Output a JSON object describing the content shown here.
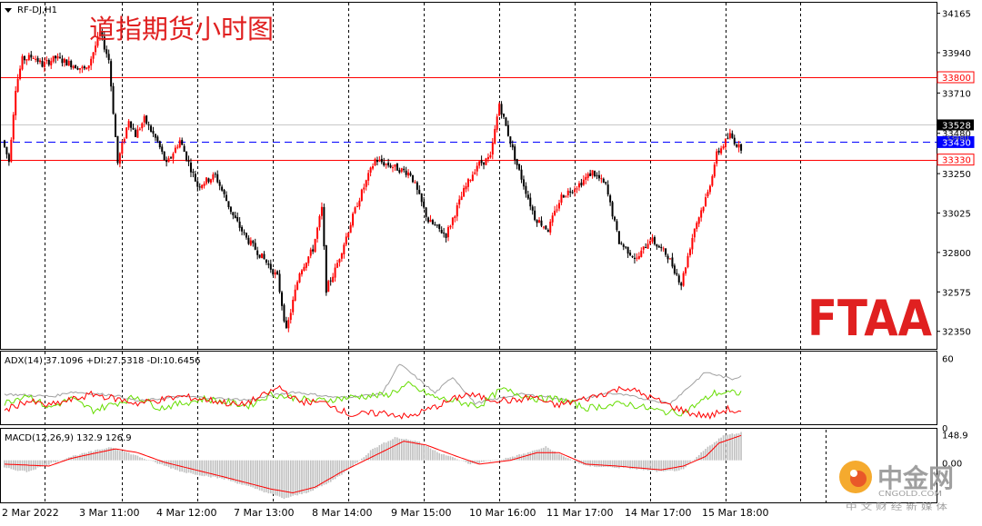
{
  "window": {
    "symbol_label": "RF-DJ,H1",
    "title": "道指期货小时图",
    "watermark_brand": "FTAA",
    "watermark_cn": "中金网",
    "watermark_site": "CNGOLD.COM",
    "watermark_sub": "中 文 财 经 新 媒 体"
  },
  "colors": {
    "bull": "#ff0000",
    "bear": "#000000",
    "level_red": "#ff0000",
    "level_blue": "#0000ff",
    "adx_line": "#a0a0a0",
    "di_plus": "#66dd00",
    "di_minus": "#ff0000",
    "macd_hist": "#c0c0c0",
    "macd_signal": "#ff0000",
    "brand_red": "#e02020"
  },
  "chart_data": [
    {
      "type": "candlestick",
      "title": "道指期货小时图",
      "symbol": "RF-DJ,H1",
      "ylim": [
        32250,
        34220
      ],
      "y_ticks": [
        34165,
        33940,
        33710,
        33480,
        33250,
        33025,
        32800,
        32575,
        32350
      ],
      "x_tick_labels": [
        "2 Mar 2022",
        "3 Mar 11:00",
        "4 Mar 12:00",
        "7 Mar 13:00",
        "8 Mar 14:00",
        "9 Mar 15:00",
        "10 Mar 16:00",
        "11 Mar 17:00",
        "14 Mar 17:00",
        "15 Mar 18:00"
      ],
      "levels": [
        {
          "value": 33800,
          "label": "33800",
          "color": "red"
        },
        {
          "value": 33430,
          "label": "33430",
          "color": "blue",
          "style": "dashed"
        },
        {
          "value": 33330,
          "label": "33330",
          "color": "red"
        }
      ],
      "last_price": {
        "value": 33528,
        "label": "33528"
      },
      "hidden_label": "33480",
      "path": [
        [
          0,
          33440
        ],
        [
          3,
          33320
        ],
        [
          6,
          33740
        ],
        [
          9,
          33900
        ],
        [
          14,
          33920
        ],
        [
          18,
          33870
        ],
        [
          24,
          33910
        ],
        [
          30,
          33880
        ],
        [
          38,
          33840
        ],
        [
          44,
          34050
        ],
        [
          48,
          33900
        ],
        [
          52,
          33310
        ],
        [
          57,
          33560
        ],
        [
          60,
          33470
        ],
        [
          64,
          33560
        ],
        [
          70,
          33430
        ],
        [
          74,
          33300
        ],
        [
          80,
          33440
        ],
        [
          88,
          33180
        ],
        [
          96,
          33240
        ],
        [
          104,
          33010
        ],
        [
          110,
          32880
        ],
        [
          118,
          32760
        ],
        [
          124,
          32660
        ],
        [
          128,
          32350
        ],
        [
          134,
          32690
        ],
        [
          140,
          32820
        ],
        [
          144,
          33050
        ],
        [
          146,
          32590
        ],
        [
          150,
          32700
        ],
        [
          160,
          33080
        ],
        [
          168,
          33330
        ],
        [
          174,
          33300
        ],
        [
          184,
          33250
        ],
        [
          192,
          32980
        ],
        [
          200,
          32900
        ],
        [
          208,
          33150
        ],
        [
          214,
          33300
        ],
        [
          220,
          33340
        ],
        [
          224,
          33650
        ],
        [
          232,
          33300
        ],
        [
          240,
          33000
        ],
        [
          246,
          32930
        ],
        [
          252,
          33120
        ],
        [
          260,
          33190
        ],
        [
          266,
          33260
        ],
        [
          272,
          33180
        ],
        [
          278,
          32860
        ],
        [
          286,
          32760
        ],
        [
          292,
          32880
        ],
        [
          300,
          32780
        ],
        [
          306,
          32620
        ],
        [
          312,
          32940
        ],
        [
          318,
          33140
        ],
        [
          322,
          33360
        ],
        [
          328,
          33470
        ],
        [
          332,
          33400
        ]
      ]
    },
    {
      "type": "line",
      "title": "ADX(14) 37.1096 +DI:27.5318 -DI:10.6456",
      "adx": 37.1096,
      "plus_di": 27.5318,
      "minus_di": 10.6456,
      "ylim": [
        0,
        62
      ],
      "y_ticks": [
        60,
        0
      ],
      "series": [
        {
          "name": "ADX",
          "key": "adx",
          "path": [
            [
              0,
              26
            ],
            [
              22,
              24
            ],
            [
              30,
              28
            ],
            [
              50,
              25
            ],
            [
              60,
              20
            ],
            [
              80,
              24
            ],
            [
              110,
              21
            ],
            [
              130,
              28
            ],
            [
              150,
              23
            ],
            [
              170,
              26
            ],
            [
              178,
              52
            ],
            [
              184,
              43
            ],
            [
              194,
              27
            ],
            [
              202,
              41
            ],
            [
              212,
              18
            ],
            [
              232,
              26
            ],
            [
              244,
              24
            ],
            [
              256,
              20
            ],
            [
              272,
              27
            ],
            [
              280,
              25
            ],
            [
              300,
              18
            ],
            [
              316,
              45
            ],
            [
              328,
              39
            ],
            [
              332,
              42
            ]
          ]
        },
        {
          "name": "+DI",
          "key": "plus",
          "path": [
            [
              0,
              18
            ],
            [
              10,
              26
            ],
            [
              20,
              14
            ],
            [
              30,
              22
            ],
            [
              40,
              12
            ],
            [
              60,
              24
            ],
            [
              70,
              14
            ],
            [
              90,
              22
            ],
            [
              110,
              16
            ],
            [
              120,
              26
            ],
            [
              140,
              20
            ],
            [
              160,
              24
            ],
            [
              172,
              25
            ],
            [
              182,
              34
            ],
            [
              194,
              23
            ],
            [
              214,
              16
            ],
            [
              224,
              30
            ],
            [
              240,
              22
            ],
            [
              250,
              22
            ],
            [
              262,
              14
            ],
            [
              280,
              18
            ],
            [
              296,
              11
            ],
            [
              306,
              10
            ],
            [
              316,
              22
            ],
            [
              320,
              27
            ],
            [
              332,
              27
            ]
          ]
        },
        {
          "name": "-DI",
          "key": "minus",
          "path": [
            [
              0,
              12
            ],
            [
              10,
              20
            ],
            [
              20,
              16
            ],
            [
              40,
              26
            ],
            [
              60,
              18
            ],
            [
              80,
              24
            ],
            [
              96,
              20
            ],
            [
              106,
              16
            ],
            [
              116,
              24
            ],
            [
              124,
              32
            ],
            [
              132,
              20
            ],
            [
              146,
              18
            ],
            [
              156,
              8
            ],
            [
              172,
              10
            ],
            [
              182,
              6
            ],
            [
              194,
              15
            ],
            [
              208,
              26
            ],
            [
              218,
              22
            ],
            [
              230,
              20
            ],
            [
              238,
              24
            ],
            [
              248,
              16
            ],
            [
              262,
              22
            ],
            [
              280,
              32
            ],
            [
              290,
              24
            ],
            [
              300,
              16
            ],
            [
              310,
              9
            ],
            [
              318,
              7
            ],
            [
              326,
              13
            ],
            [
              332,
              9
            ]
          ]
        }
      ]
    },
    {
      "type": "bar",
      "title": "MACD(12,26,9) 132.9 126.9",
      "macd": 132.9,
      "signal": 126.9,
      "ylim": [
        -220,
        160
      ],
      "y_ticks": [
        148.9,
        0.0
      ],
      "y_tick_labels": [
        "148.9",
        "0.00"
      ],
      "hist_path": [
        [
          0,
          -40
        ],
        [
          10,
          -60
        ],
        [
          30,
          20
        ],
        [
          48,
          70
        ],
        [
          58,
          30
        ],
        [
          70,
          -20
        ],
        [
          80,
          -60
        ],
        [
          100,
          -100
        ],
        [
          116,
          -160
        ],
        [
          126,
          -200
        ],
        [
          136,
          -170
        ],
        [
          146,
          -120
        ],
        [
          156,
          -40
        ],
        [
          166,
          60
        ],
        [
          176,
          120
        ],
        [
          186,
          100
        ],
        [
          196,
          40
        ],
        [
          210,
          -20
        ],
        [
          226,
          10
        ],
        [
          236,
          40
        ],
        [
          244,
          70
        ],
        [
          252,
          20
        ],
        [
          262,
          -30
        ],
        [
          280,
          -40
        ],
        [
          296,
          -60
        ],
        [
          306,
          -50
        ],
        [
          316,
          60
        ],
        [
          324,
          130
        ],
        [
          332,
          145
        ]
      ],
      "signal_path": [
        [
          0,
          -20
        ],
        [
          20,
          -30
        ],
        [
          30,
          10
        ],
        [
          50,
          60
        ],
        [
          60,
          40
        ],
        [
          72,
          -10
        ],
        [
          100,
          -90
        ],
        [
          120,
          -150
        ],
        [
          130,
          -170
        ],
        [
          140,
          -140
        ],
        [
          152,
          -60
        ],
        [
          166,
          20
        ],
        [
          180,
          100
        ],
        [
          190,
          80
        ],
        [
          204,
          20
        ],
        [
          214,
          -20
        ],
        [
          228,
          0
        ],
        [
          240,
          40
        ],
        [
          250,
          40
        ],
        [
          262,
          -20
        ],
        [
          276,
          -30
        ],
        [
          296,
          -50
        ],
        [
          306,
          -30
        ],
        [
          316,
          20
        ],
        [
          322,
          90
        ],
        [
          332,
          130
        ]
      ]
    }
  ]
}
